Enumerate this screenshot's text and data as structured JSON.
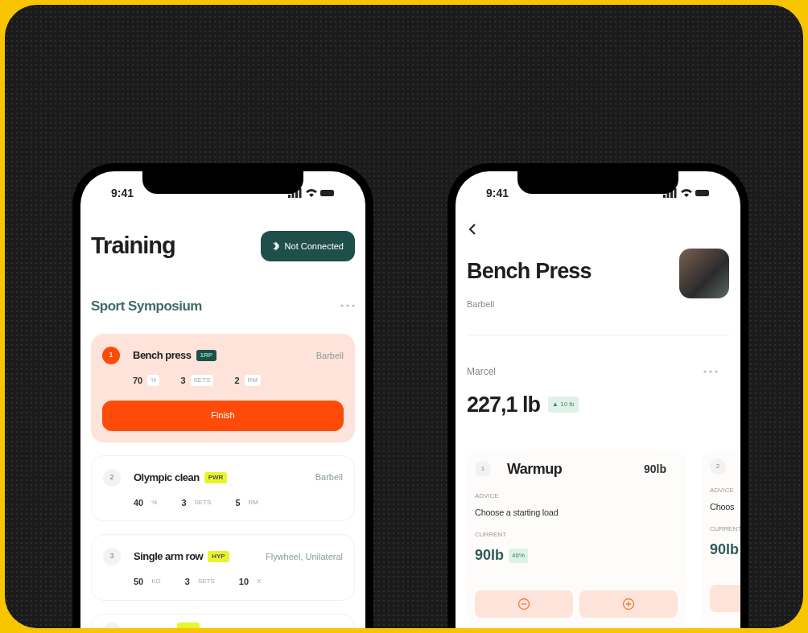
{
  "left_phone": {
    "status_time": "9:41",
    "title": "Training",
    "connect_button": "Not Connected",
    "section": "Sport Symposium",
    "exercises": [
      {
        "number": "1",
        "name": "Bench press",
        "tag": "1RP",
        "color": "#1f4f4a",
        "equipment": "Barbell",
        "active": true,
        "action": "Finish",
        "stats": [
          {
            "value": "70",
            "unit": "%"
          },
          {
            "value": "3",
            "unit": "SETS"
          },
          {
            "value": "2",
            "unit": "RM"
          }
        ]
      },
      {
        "number": "2",
        "name": "Olympic clean",
        "tag": "PWR",
        "color": "#e8f52a",
        "equipment": "Barbell",
        "active": false,
        "stats": [
          {
            "value": "40",
            "unit": "%"
          },
          {
            "value": "3",
            "unit": "SETS"
          },
          {
            "value": "5",
            "unit": "RM"
          }
        ]
      },
      {
        "number": "3",
        "name": "Single arm row",
        "tag": "HYP",
        "color": "#e8f52a",
        "equipment": "Flywheel, Unilateral",
        "active": false,
        "stats": [
          {
            "value": "50",
            "unit": "KG"
          },
          {
            "value": "3",
            "unit": "SETS"
          },
          {
            "value": "10",
            "unit": "X"
          }
        ]
      }
    ]
  },
  "right_phone": {
    "status_time": "9:41",
    "title": "Bench Press",
    "subtitle": "Barbell",
    "athlete": "Marcel",
    "weight": "227,1 lb",
    "change": "▲ 10 lb",
    "sets": [
      {
        "number": "1",
        "name": "Warmup",
        "target": "90lb",
        "advice_label": "ADVICE",
        "advice": "Choose a starting load",
        "current_label": "CURRENT",
        "current": "90lb",
        "percent": "46%"
      },
      {
        "number": "2",
        "advice_label": "ADVICE",
        "advice": "Choos",
        "current_label": "CURRENT",
        "current": "90lb"
      }
    ]
  }
}
